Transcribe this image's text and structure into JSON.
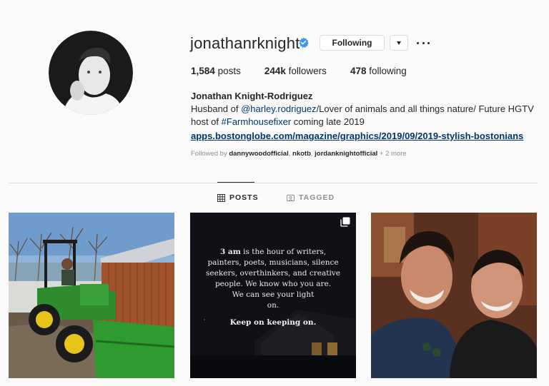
{
  "profile": {
    "username": "jonathanrknight",
    "verified": true,
    "following_button": "Following",
    "stats": {
      "posts_count": "1,584",
      "posts_label": "posts",
      "followers_count": "244k",
      "followers_label": "followers",
      "following_count": "478",
      "following_label": "following"
    },
    "full_name": "Jonathan Knight-Rodriguez",
    "bio": {
      "part1": "Husband of ",
      "mention": "@harley.rodriguez",
      "part2": "/Lover of animals and all things nature/ Future HGTV host of ",
      "hashtag": "#Farmhousefixer",
      "part3": " coming late 2019"
    },
    "website": "apps.bostonglobe.com/magazine/graphics/2019/09/2019-stylish-bostonians",
    "followed_by": {
      "prefix": "Followed by ",
      "user1": "dannywoodofficial",
      "sep1": ", ",
      "user2": "nkotb",
      "sep2": ", ",
      "user3": "jordanknightofficial",
      "suffix": " + 2 more"
    }
  },
  "tabs": [
    {
      "label": "POSTS",
      "icon": "grid-icon",
      "active": true
    },
    {
      "label": "TAGGED",
      "icon": "tag-icon",
      "active": false
    }
  ],
  "posts": [
    {
      "subject": "tractor-photo"
    },
    {
      "subject": "quote-card",
      "lines": [
        "3 am",
        " is the hour of writers,",
        "painters, poets, musicians, silence",
        "seekers, overthinkers, and creative",
        "people. We know who you are.",
        "We can see your light",
        "on."
      ],
      "cta": "Keep on keeping on.",
      "icon": "carousel-icon"
    },
    {
      "subject": "couple-photo"
    }
  ],
  "colors": {
    "link": "#00376b",
    "verified": "#3897f0",
    "text": "#262626",
    "muted": "#8e8e8e",
    "border": "#dbdbdb",
    "background": "#fafafa"
  }
}
